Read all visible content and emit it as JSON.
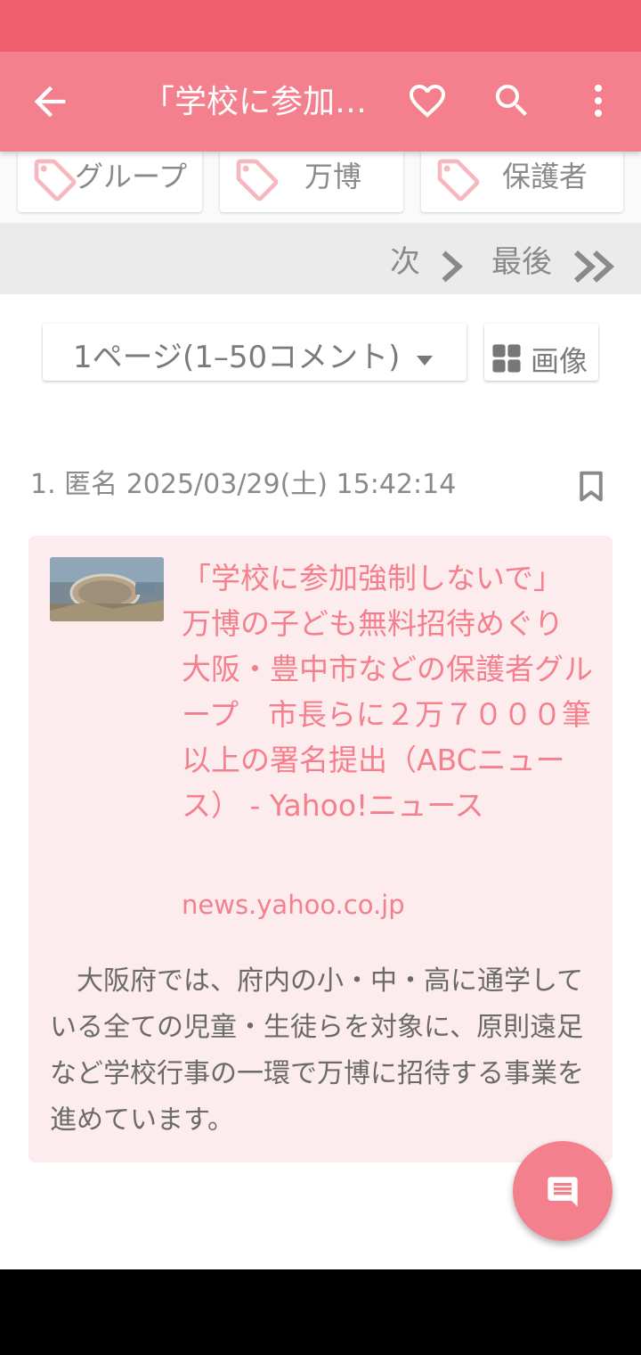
{
  "toolbar": {
    "title": "「学校に参加強制しないで」　万博の子ども無料招待めぐり　大阪・豊中市などの保護者グループ　市長らに２万７０００筆以上の署名提出（ABCニュース） - Yahoo!ニュース",
    "icons": [
      "back-arrow-icon",
      "heart-icon",
      "search-icon",
      "more-vert-icon"
    ]
  },
  "tags": [
    {
      "label": "グループ"
    },
    {
      "label": "万博"
    },
    {
      "label": "保護者"
    }
  ],
  "pager": {
    "next_label": "次",
    "last_label": "最後"
  },
  "page_select": {
    "selected": "1ページ(1–50コメント)"
  },
  "image_button": {
    "label": "画像"
  },
  "comment": {
    "header": "1. 匿名 2025/03/29(土) 15:42:14",
    "link": {
      "title": "「学校に参加強制しないで」　万博の子ども無料招待めぐり　大阪・豊中市などの保護者グループ　市長らに２万７０００筆以上の署名提出（ABCニュース） - Yahoo!ニュース",
      "domain": "news.yahoo.co.jp",
      "description": "　大阪府では、府内の小・中・高に通学している全ての児童・生徒らを対象に、原則遠足など学校行事の一環で万博に招待する事業を進めています。"
    }
  },
  "colors": {
    "status_bar": "#f06070",
    "toolbar": "#f4808d",
    "accent_text": "#f4808d",
    "card_bg": "#fdecee"
  }
}
